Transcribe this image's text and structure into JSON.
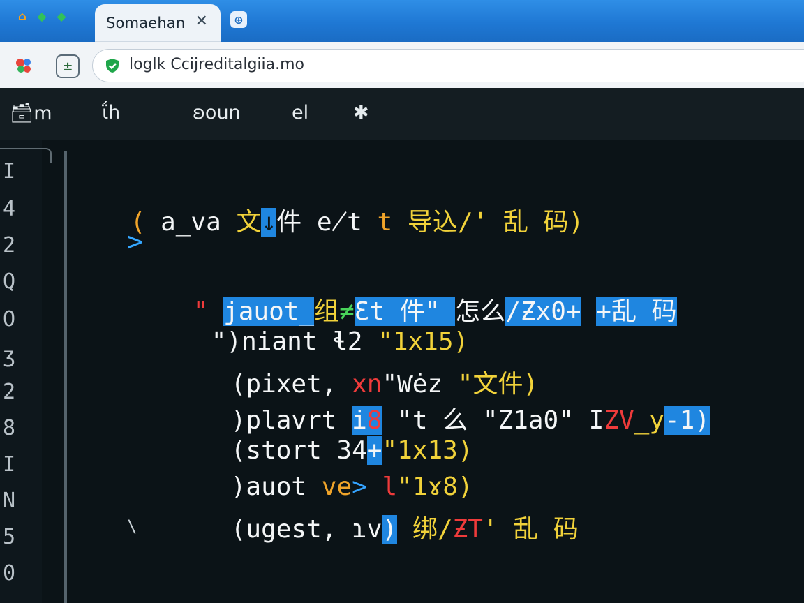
{
  "window": {
    "tab_title": "Somaehan",
    "tab_close": "✕",
    "new_tab": "⊕",
    "controls": [
      "⌂",
      "◆",
      "◆"
    ]
  },
  "toolbar": {
    "dev_button": "±",
    "url": "loglk Ccijreditalgiia.mo"
  },
  "menu": {
    "items": [
      "🗃m",
      "ΐh",
      "ʚoun",
      "el",
      "✱"
    ]
  },
  "editor": {
    "line_numbers": [
      "I",
      "4",
      "2",
      "Q",
      "O",
      "ʒ",
      "2",
      "8",
      "I",
      "N",
      "5",
      "0"
    ],
    "fold_arrow": ">",
    "end_mark": "\\",
    "lines": {
      "l1_a": "( ",
      "l1_b": "a_va ",
      "l1_c": "文",
      "l1_d": "↓",
      "l1_e": "件 ",
      "l1_f": "e̸t ",
      "l1_g": "t ",
      "l1_h": "导込/' 乱 码)",
      "l3_a": "\" ",
      "l3_b": "jauot_",
      "l3_c": "组",
      "l3_d": "≠",
      "l3_e": "Ɛt 件\" ",
      "l3_f": "怎么",
      "l3_g": "/Ƶx0+",
      "l3_h": " ",
      "l3_i": "+乱 码",
      "l4_a": "\")",
      "l4_b": "niant ",
      "l4_c": "ɬ2 ",
      "l4_d": "\"1x15)",
      "l5_a": "(",
      "l5_b": "pixet, ",
      "l5_c": "xn",
      "l5_d": "\"Ⱳėz ",
      "l5_e": "\"文件)",
      "l6_a": ")",
      "l6_b": "plavrt ",
      "l6_c": "i",
      "l6_d": "8",
      "l6_e": " \"t 么 \"Z1a0\" ",
      "l6_f": "I",
      "l6_g": "ZV",
      "l6_h": "_y",
      "l6_i": "-1)",
      "l7_a": "(",
      "l7_b": "stort 34",
      "l7_c": "+",
      "l7_d": "\"1x13)",
      "l8_a": ")",
      "l8_b": "auot ",
      "l8_c": "ve",
      "l8_d": "> ",
      "l8_e": "l",
      "l8_f": "\"1ɤ8)",
      "l9_a": "(",
      "l9_b": "ugest, ",
      "l9_c": "ɿv",
      "l9_d": ")",
      "l9_e": " 绑/",
      "l9_f": "ƵT",
      "l9_g": "' 乱 码"
    }
  },
  "colors": {
    "titlebar": "#1f78d4",
    "editor_bg": "#0b1317",
    "accent_blue": "#1f86e0",
    "keyword_yellow": "#f1d23a",
    "error_red": "#ef3b3b",
    "ok_green": "#49d35a"
  },
  "icons": {
    "extension": "pinwheel-icon",
    "secure": "shield-check-icon",
    "tab_close": "close-icon",
    "new_tab": "new-tab-icon"
  }
}
